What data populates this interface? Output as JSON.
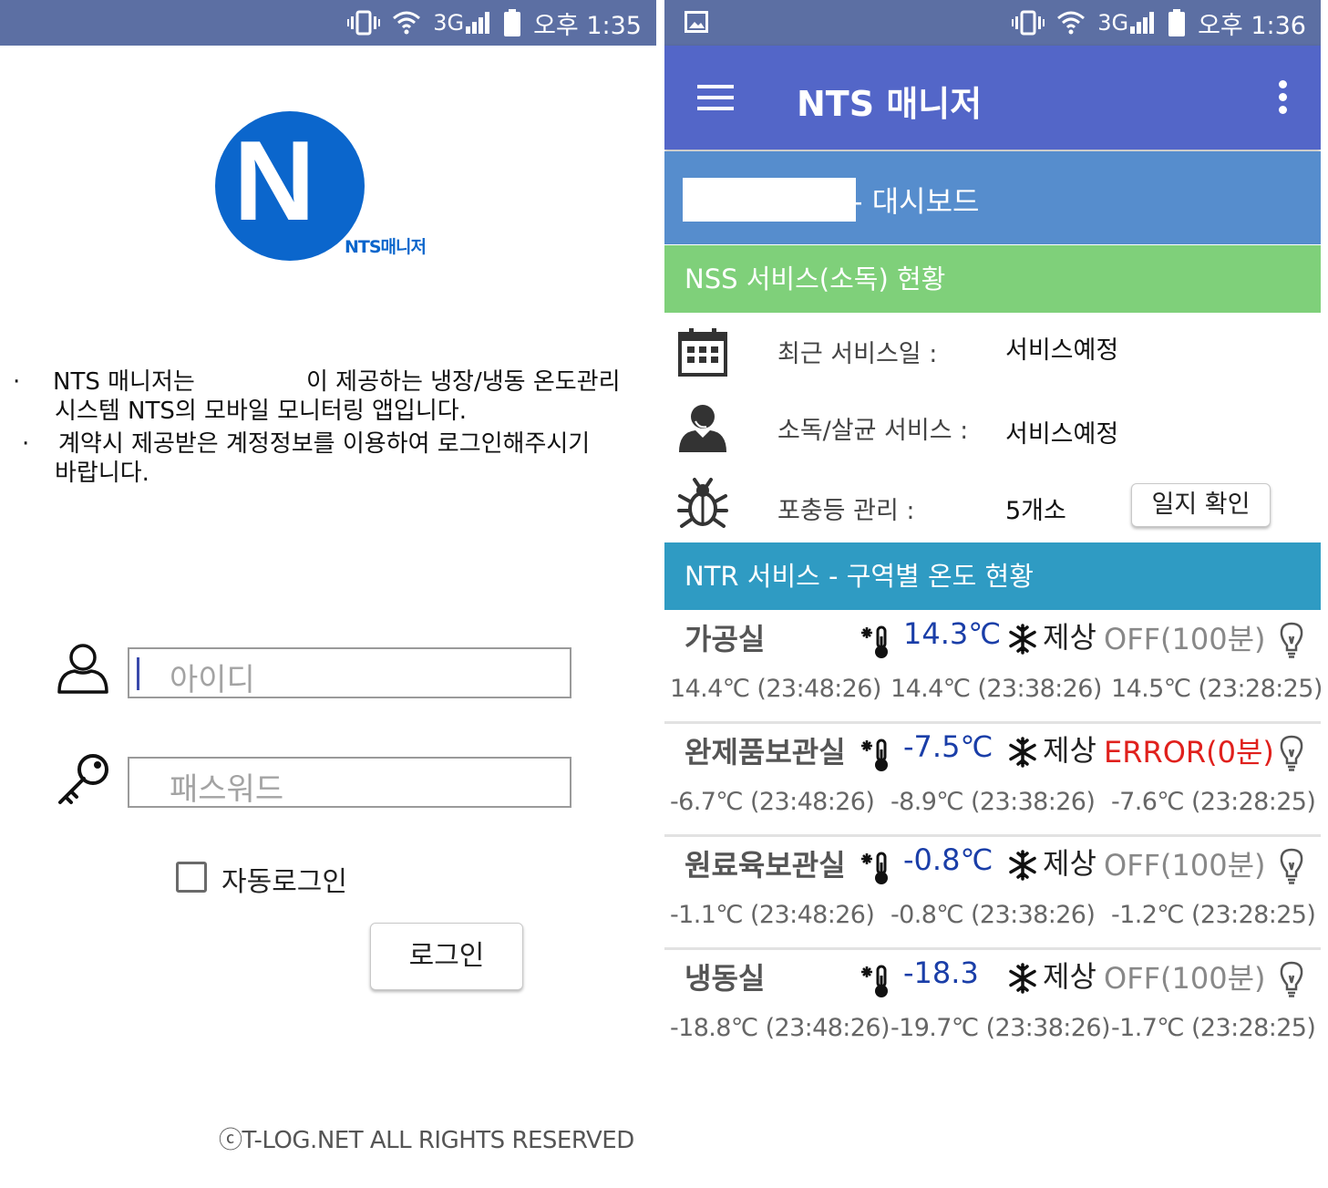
{
  "left_screen": {
    "status_bar": {
      "network": "3G",
      "time": "오후 1:35"
    },
    "logo": {
      "letter": "N",
      "caption": "NTS매니저"
    },
    "intro": {
      "bullet": "·",
      "line1a": "NTS 매니저는",
      "line1b": "이 제공하는 냉장/냉동 온도관리",
      "line2": "시스템 NTS의 모바일 모니터링 앱입니다.",
      "line3": "계약시 제공받은 계정정보를 이용하여 로그인해주시기",
      "line4": "바랍니다."
    },
    "id_field": {
      "placeholder": "아이디"
    },
    "password_field": {
      "placeholder": "패스워드"
    },
    "auto_login": {
      "label": "자동로그인",
      "checked": false
    },
    "login_button": "로그인",
    "copyright": "ⓒT-LOG.NET ALL RIGHTS RESERVED"
  },
  "right_screen": {
    "status_bar": {
      "network": "3G",
      "time": "오후 1:36"
    },
    "app_bar": {
      "title": "NTS 매니저"
    },
    "dashboard": {
      "title": "- 대시보드"
    },
    "nss": {
      "heading": "NSS 서비스(소독) 현황",
      "rows": [
        {
          "icon": "calendar-icon",
          "label": "최근 서비스일 :",
          "value": "서비스예정"
        },
        {
          "icon": "worker-icon",
          "label": "소독/살균 서비스 :",
          "value": "서비스예정"
        },
        {
          "icon": "bug-icon",
          "label": "포충등 관리 :",
          "value": "5개소"
        }
      ],
      "log_button": "일지 확인"
    },
    "ntr": {
      "heading": "NTR 서비스 - 구역별 온도 현황",
      "defrost_label": "제상",
      "zones": [
        {
          "name": "가공실",
          "temp": "14.3℃",
          "defrost": "OFF(100분)",
          "defrost_error": false,
          "history": [
            "14.4℃ (23:48:26)",
            "14.4℃ (23:38:26)",
            "14.5℃ (23:28:25)"
          ]
        },
        {
          "name": "완제품보관실",
          "temp": "-7.5℃",
          "defrost": "ERROR(0분)",
          "defrost_error": true,
          "history": [
            "-6.7℃ (23:48:26)",
            "-8.9℃ (23:38:26)",
            "-7.6℃ (23:28:25)"
          ]
        },
        {
          "name": "원료육보관실",
          "temp": "-0.8℃",
          "defrost": "OFF(100분)",
          "defrost_error": false,
          "history": [
            "-1.1℃ (23:48:26)",
            "-0.8℃ (23:38:26)",
            "-1.2℃ (23:28:25)"
          ]
        },
        {
          "name": "냉동실",
          "temp": "-18.3",
          "defrost": "OFF(100분)",
          "defrost_error": false,
          "history": [
            "-18.8℃ (23:48:26)",
            "-19.7℃ (23:38:26)",
            "-1.7℃ (23:28:25)"
          ]
        }
      ]
    }
  },
  "colors": {
    "status_bar": "#5c6fa3",
    "app_bar": "#5366c8",
    "dashboard_bar": "#568dcd",
    "nss_header": "#7fd07a",
    "ntr_header": "#2f9bc3",
    "logo_blue": "#0b66cc",
    "temp_blue": "#1a3ea8",
    "error_red": "#e0201c"
  }
}
